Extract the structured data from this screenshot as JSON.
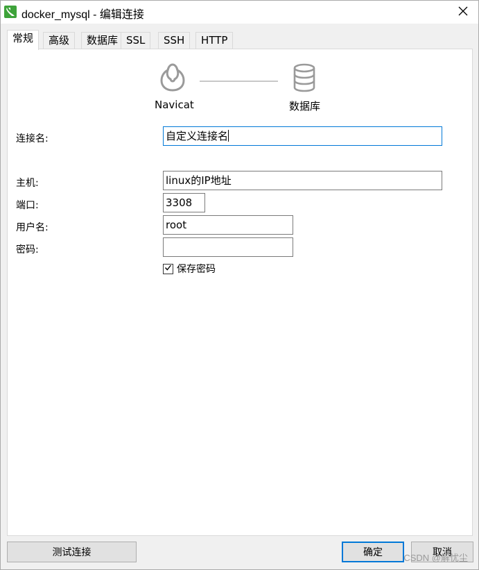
{
  "window": {
    "title": "docker_mysql - 编辑连接",
    "app_icon": "navicat-icon",
    "close_icon": "close-icon"
  },
  "tabs": [
    {
      "label": "常规",
      "active": true
    },
    {
      "label": "高级",
      "active": false
    },
    {
      "label": "数据库",
      "active": false
    },
    {
      "label": "SSL",
      "active": false
    },
    {
      "label": "SSH",
      "active": false
    },
    {
      "label": "HTTP",
      "active": false
    }
  ],
  "diagram": {
    "left_label": "Navicat",
    "left_icon": "navicat-logo-icon",
    "right_label": "数据库",
    "right_icon": "database-icon"
  },
  "form": {
    "connection_name": {
      "label": "连接名:",
      "value": "自定义连接名"
    },
    "host": {
      "label": "主机:",
      "value": "linux的IP地址"
    },
    "port": {
      "label": "端口:",
      "value": "3308"
    },
    "username": {
      "label": "用户名:",
      "value": "root"
    },
    "password": {
      "label": "密码:",
      "value": ""
    },
    "save_password": {
      "label": "保存密码",
      "checked": true
    }
  },
  "buttons": {
    "test": "测试连接",
    "ok": "确定",
    "cancel": "取消"
  },
  "watermark": "CSDN @解忧尘",
  "colors": {
    "accent": "#0078d7",
    "app_icon": "#3ea33a"
  }
}
